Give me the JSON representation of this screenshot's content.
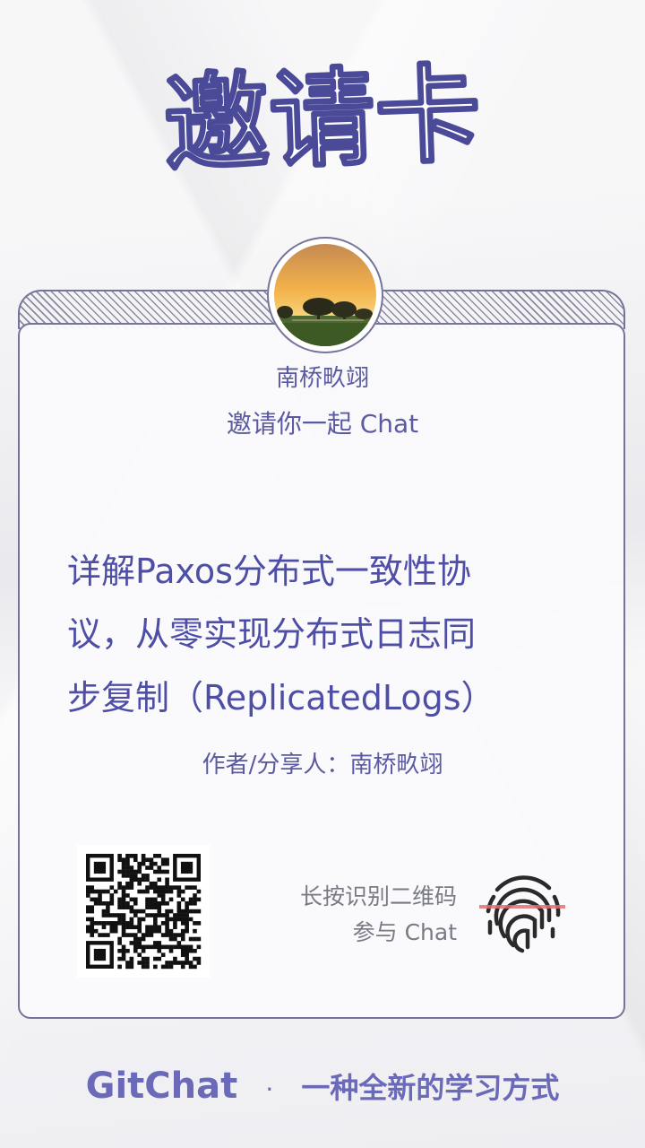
{
  "title": "邀请卡",
  "user": {
    "name": "南桥畂翊",
    "invite_text": "邀请你一起 Chat"
  },
  "topic": {
    "line1": "详解Paxos分布式一致性协",
    "line2": "议，从零实现分布式日志同",
    "line3": "步复制（ReplicatedLogs）"
  },
  "author_line": "作者/分享人：南桥畂翊",
  "qr_hint": {
    "line1": "长按识别二维码",
    "line2": "参与 Chat"
  },
  "footer": {
    "brand": "GitChat",
    "dot": "·",
    "slogan": "一种全新的学习方式"
  },
  "icons": {
    "fingerprint": "fingerprint-icon",
    "qr": "qr-code"
  },
  "colors": {
    "accent": "#5a5aa0",
    "brand": "#6a6ab8",
    "card_border": "#74749a",
    "fingerprint_line": "#e07070"
  }
}
